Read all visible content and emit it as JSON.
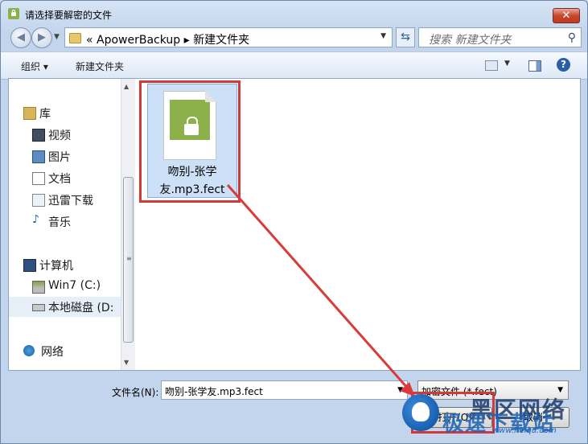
{
  "window": {
    "title": "请选择要解密的文件",
    "close": "✕"
  },
  "nav": {
    "back": "◀",
    "forward": "▶",
    "address_path": "« ApowerBackup ▸ 新建文件夹",
    "search_placeholder": "搜索 新建文件夹"
  },
  "toolbar": {
    "organize": "组织 ▾",
    "new_folder": "新建文件夹",
    "help": "?"
  },
  "sidebar": {
    "items": [
      {
        "label": "库",
        "icon": "library-icon"
      },
      {
        "label": "视频",
        "icon": "video-icon"
      },
      {
        "label": "图片",
        "icon": "picture-icon"
      },
      {
        "label": "文档",
        "icon": "document-icon"
      },
      {
        "label": "迅雷下载",
        "icon": "download-icon"
      },
      {
        "label": "音乐",
        "icon": "music-icon"
      },
      {
        "label": "计算机",
        "icon": "computer-icon"
      },
      {
        "label": "Win7 (C:)",
        "icon": "system-drive-icon"
      },
      {
        "label": "本地磁盘 (D:",
        "icon": "drive-icon"
      },
      {
        "label": "网络",
        "icon": "network-icon"
      }
    ]
  },
  "files": [
    {
      "name": "吻别-张学友.mp3.fect",
      "icon": "encrypted-file-icon"
    }
  ],
  "bottom": {
    "filename_label": "文件名(N):",
    "filename_value": "吻别-张学友.mp3.fect",
    "filter_value": "加密文件 (*.fect)",
    "open_label": "打开(O)",
    "cancel_label": "取消"
  },
  "watermark": {
    "text1": "黑区网络",
    "text2": "极速下载站",
    "url": "www.heiqu.com"
  },
  "colors": {
    "highlight_red": "#d23a3a",
    "lock_green": "#8cb04a",
    "selection_blue": "#cce1f8"
  }
}
